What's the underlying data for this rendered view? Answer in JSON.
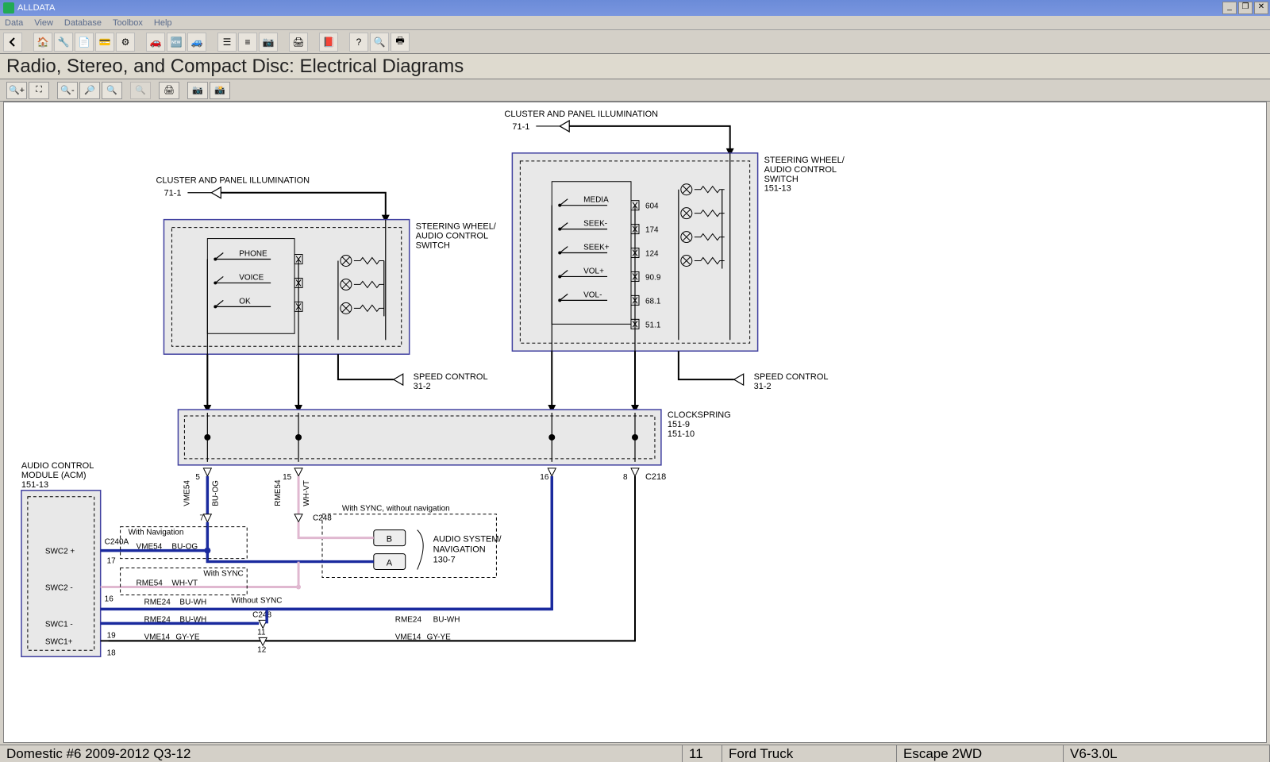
{
  "window": {
    "title": "ALLDATA",
    "min": "_",
    "max": "❐",
    "close": "✕"
  },
  "menu": {
    "items": [
      "Data",
      "View",
      "Database",
      "Toolbox",
      "Help"
    ]
  },
  "heading": "Radio, Stereo, and Compact Disc:  Electrical Diagrams",
  "statusbar": {
    "dataset": "Domestic #6 2009-2012 Q3-12",
    "page": "11",
    "make": "Ford Truck",
    "model": "Escape 2WD",
    "engine": "V6-3.0L"
  },
  "diagram": {
    "labels": {
      "cpi_left": "CLUSTER AND PANEL ILLUMINATION",
      "cpi_left_ref": "71-1",
      "cpi_right": "CLUSTER AND PANEL ILLUMINATION",
      "cpi_right_ref": "71-1",
      "swacs_left": "STEERING WHEEL/\nAUDIO CONTROL\nSWITCH",
      "swacs_right": "STEERING WHEEL/\nAUDIO CONTROL\nSWITCH",
      "swacs_right_ref": "151-13",
      "speed_left": "SPEED CONTROL",
      "speed_left_ref": "31-2",
      "speed_right": "SPEED CONTROL",
      "speed_right_ref": "31-2",
      "clockspring": "CLOCKSPRING",
      "clockspring_ref1": "151-9",
      "clockspring_ref2": "151-10",
      "acm": "AUDIO CONTROL\nMODULE (ACM)",
      "acm_ref": "151-13",
      "with_nav": "With Navigation",
      "with_sync": "With SYNC",
      "without_sync": "Without SYNC",
      "with_sync_no_nav": "With SYNC, without navigation",
      "audio_nav": "AUDIO SYSTEM/\nNAVIGATION",
      "audio_nav_ref": "130-7",
      "box_b": "B",
      "box_a": "A"
    },
    "switch_left": [
      "PHONE",
      "VOICE",
      "OK"
    ],
    "switch_right": [
      {
        "name": "MEDIA",
        "res": "604"
      },
      {
        "name": "SEEK-",
        "res": "174"
      },
      {
        "name": "SEEK+",
        "res": "124"
      },
      {
        "name": "VOL+",
        "res": "90.9"
      },
      {
        "name": "VOL-",
        "res": "68.1"
      },
      {
        "name": "",
        "res": "51.1"
      }
    ],
    "c218_pins": {
      "p5": "5",
      "p15": "15",
      "p16": "16",
      "p8": "8",
      "conn": "C218"
    },
    "c248": "C248",
    "c248b": "C248",
    "c240a": "C240A",
    "wires": {
      "vme54": "VME54",
      "vme54_color": "BU-OG",
      "rme54": "RME54",
      "rme54_color": "WH-VT",
      "rme24": "RME24",
      "rme24_color": "BU-WH",
      "vme14": "VME14",
      "vme14_color": "GY-YE"
    },
    "acm_pins": {
      "swc2p": "SWC2 +",
      "p17": "17",
      "swc2m": "SWC2 -",
      "p16": "16",
      "swc1m": "SWC1 -",
      "p19": "19",
      "swc1p": "SWC1+",
      "p18": "18",
      "p7": "7",
      "p11": "11",
      "p12": "12"
    }
  }
}
